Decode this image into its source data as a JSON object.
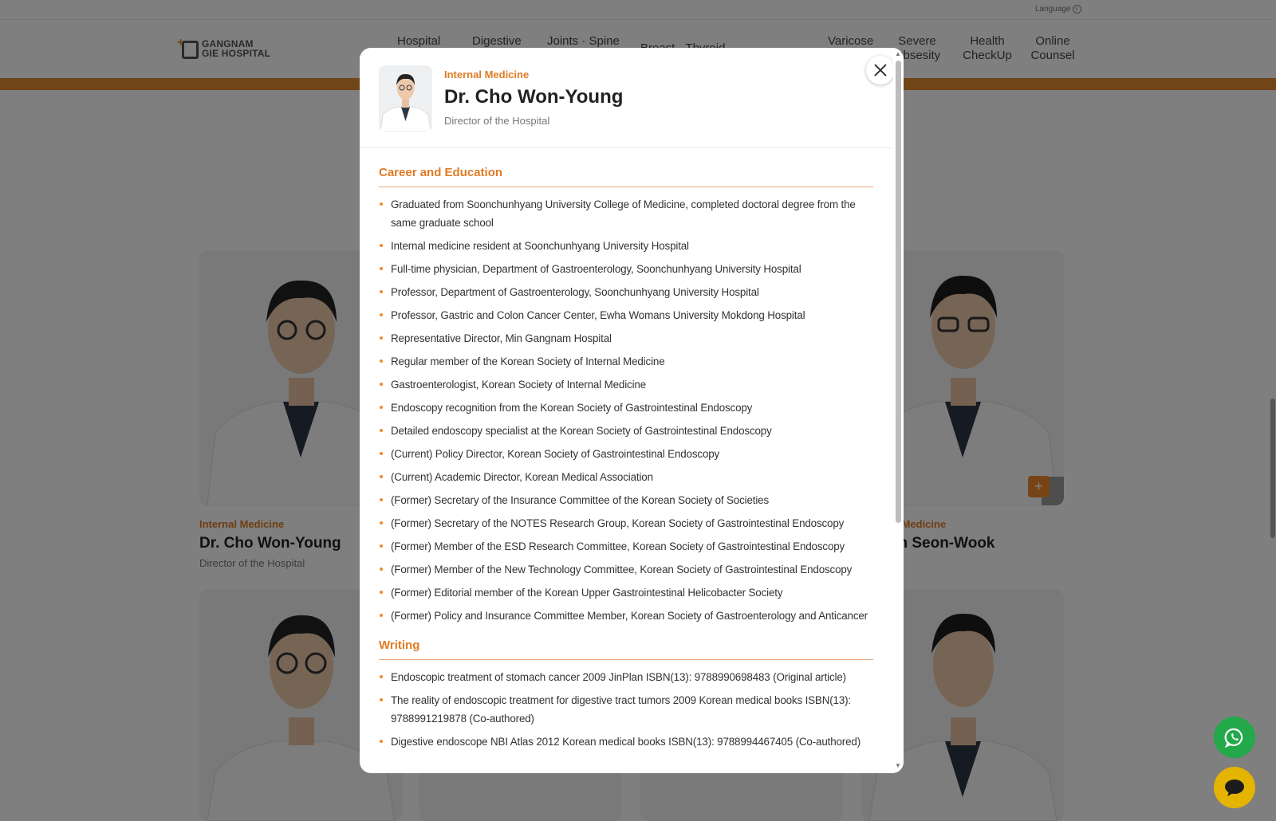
{
  "topbar": {
    "language_label": "Language"
  },
  "header": {
    "logo_line1": "GANGNAM",
    "logo_line2": "GIE HOSPITAL",
    "nav": [
      {
        "label": "Hospital"
      },
      {
        "label": "Digestive"
      },
      {
        "label": "Joints · Spine"
      },
      {
        "label": "Breast · Thyroid ..."
      },
      {
        "label": "Varicose"
      },
      {
        "label": "Severe Obsesity"
      },
      {
        "label": "Health CheckUp"
      },
      {
        "label": "Online Counsel"
      }
    ]
  },
  "cards": [
    {
      "dept": "Internal Medicine",
      "name": "Dr. Cho Won-Young",
      "title": "Director of the Hospital"
    },
    {
      "dept": "Internal Medicine",
      "name": "Dr. ...n Seon-Wook",
      "title": ""
    }
  ],
  "modal": {
    "dept": "Internal Medicine",
    "name": "Dr. Cho Won-Young",
    "title": "Director of the Hospital",
    "close_label": "×",
    "career_title": "Career and Education",
    "career": [
      "Graduated from Soonchunhyang University College of Medicine, completed doctoral degree from the same graduate school",
      "Internal medicine resident at Soonchunhyang University Hospital",
      "Full-time physician, Department of Gastroenterology, Soonchunhyang University Hospital",
      "Professor, Department of Gastroenterology, Soonchunhyang University Hospital",
      "Professor, Gastric and Colon Cancer Center, Ewha Womans University Mokdong Hospital",
      "Representative Director, Min Gangnam Hospital",
      "Regular member of the Korean Society of Internal Medicine",
      "Gastroenterologist, Korean Society of Internal Medicine",
      "Endoscopy recognition from the Korean Society of Gastrointestinal Endoscopy",
      "Detailed endoscopy specialist at the Korean Society of Gastrointestinal Endoscopy",
      "(Current) Policy Director, Korean Society of Gastrointestinal Endoscopy",
      "(Current) Academic Director, Korean Medical Association",
      "(Former) Secretary of the Insurance Committee of the Korean Society of Societies",
      "(Former) Secretary of the NOTES Research Group, Korean Society of Gastrointestinal Endoscopy",
      "(Former) Member of the ESD Research Committee, Korean Society of Gastrointestinal Endoscopy",
      "(Former) Member of the New Technology Committee, Korean Society of Gastrointestinal Endoscopy",
      "(Former) Editorial member of the Korean Upper Gastrointestinal Helicobacter Society",
      "(Former) Policy and Insurance Committee Member, Korean Society of Gastroenterology and Anticancer"
    ],
    "writing_title": "Writing",
    "writing": [
      "Endoscopic treatment of stomach cancer 2009 JinPlan ISBN(13): 9788990698483 (Original article)",
      "The reality of endoscopic treatment for digestive tract tumors 2009 Korean medical books ISBN(13): 9788991219878 (Co-authored)",
      "Digestive endoscope NBI Atlas 2012 Korean medical books ISBN(13): 9788994467405 (Co-authored)"
    ]
  },
  "colors": {
    "accent": "#e07b23",
    "band": "#e08a2e",
    "whatsapp": "#23a84a",
    "chat": "#e4b400"
  },
  "fabs": {
    "whatsapp_icon": "whatsapp-icon",
    "chat_icon": "chat-bubble-icon"
  }
}
